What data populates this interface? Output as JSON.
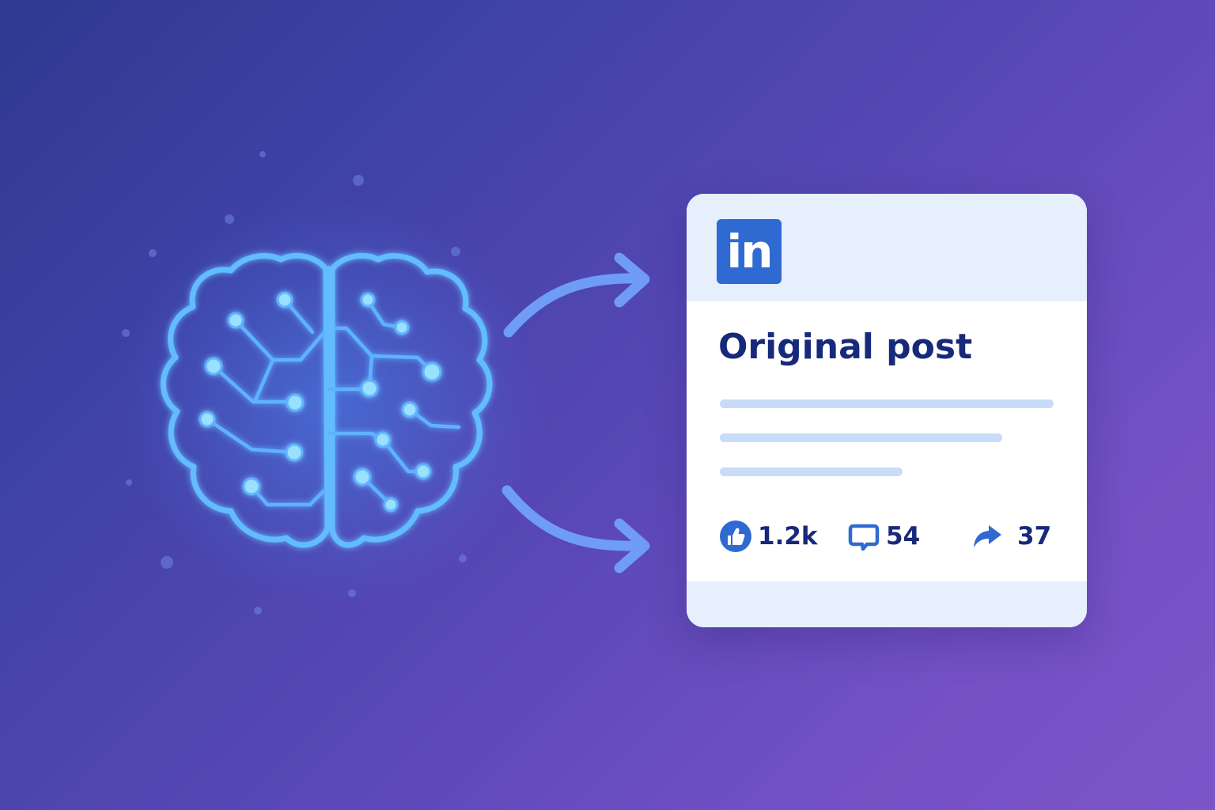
{
  "post_card": {
    "logo_text": "in",
    "title": "Original post",
    "stats": {
      "likes": "1.2k",
      "comments": "54",
      "shares": "37"
    }
  },
  "icons": {
    "brain": "brain-circuit-icon",
    "arrows": [
      "arrow-right-icon",
      "arrow-right-icon"
    ],
    "logo": "linkedin-logo",
    "likes": "thumbs-up-icon",
    "comments": "comment-bubble-icon",
    "shares": "share-arrow-icon"
  },
  "colors": {
    "background_start": "#2f3990",
    "background_end": "#7a55c8",
    "brain_glow": "#5fb7ff",
    "card_header": "#e6effc",
    "linkedin_blue": "#2e6ad2",
    "title_text": "#17297a",
    "arrow": "#6f9cf5"
  }
}
